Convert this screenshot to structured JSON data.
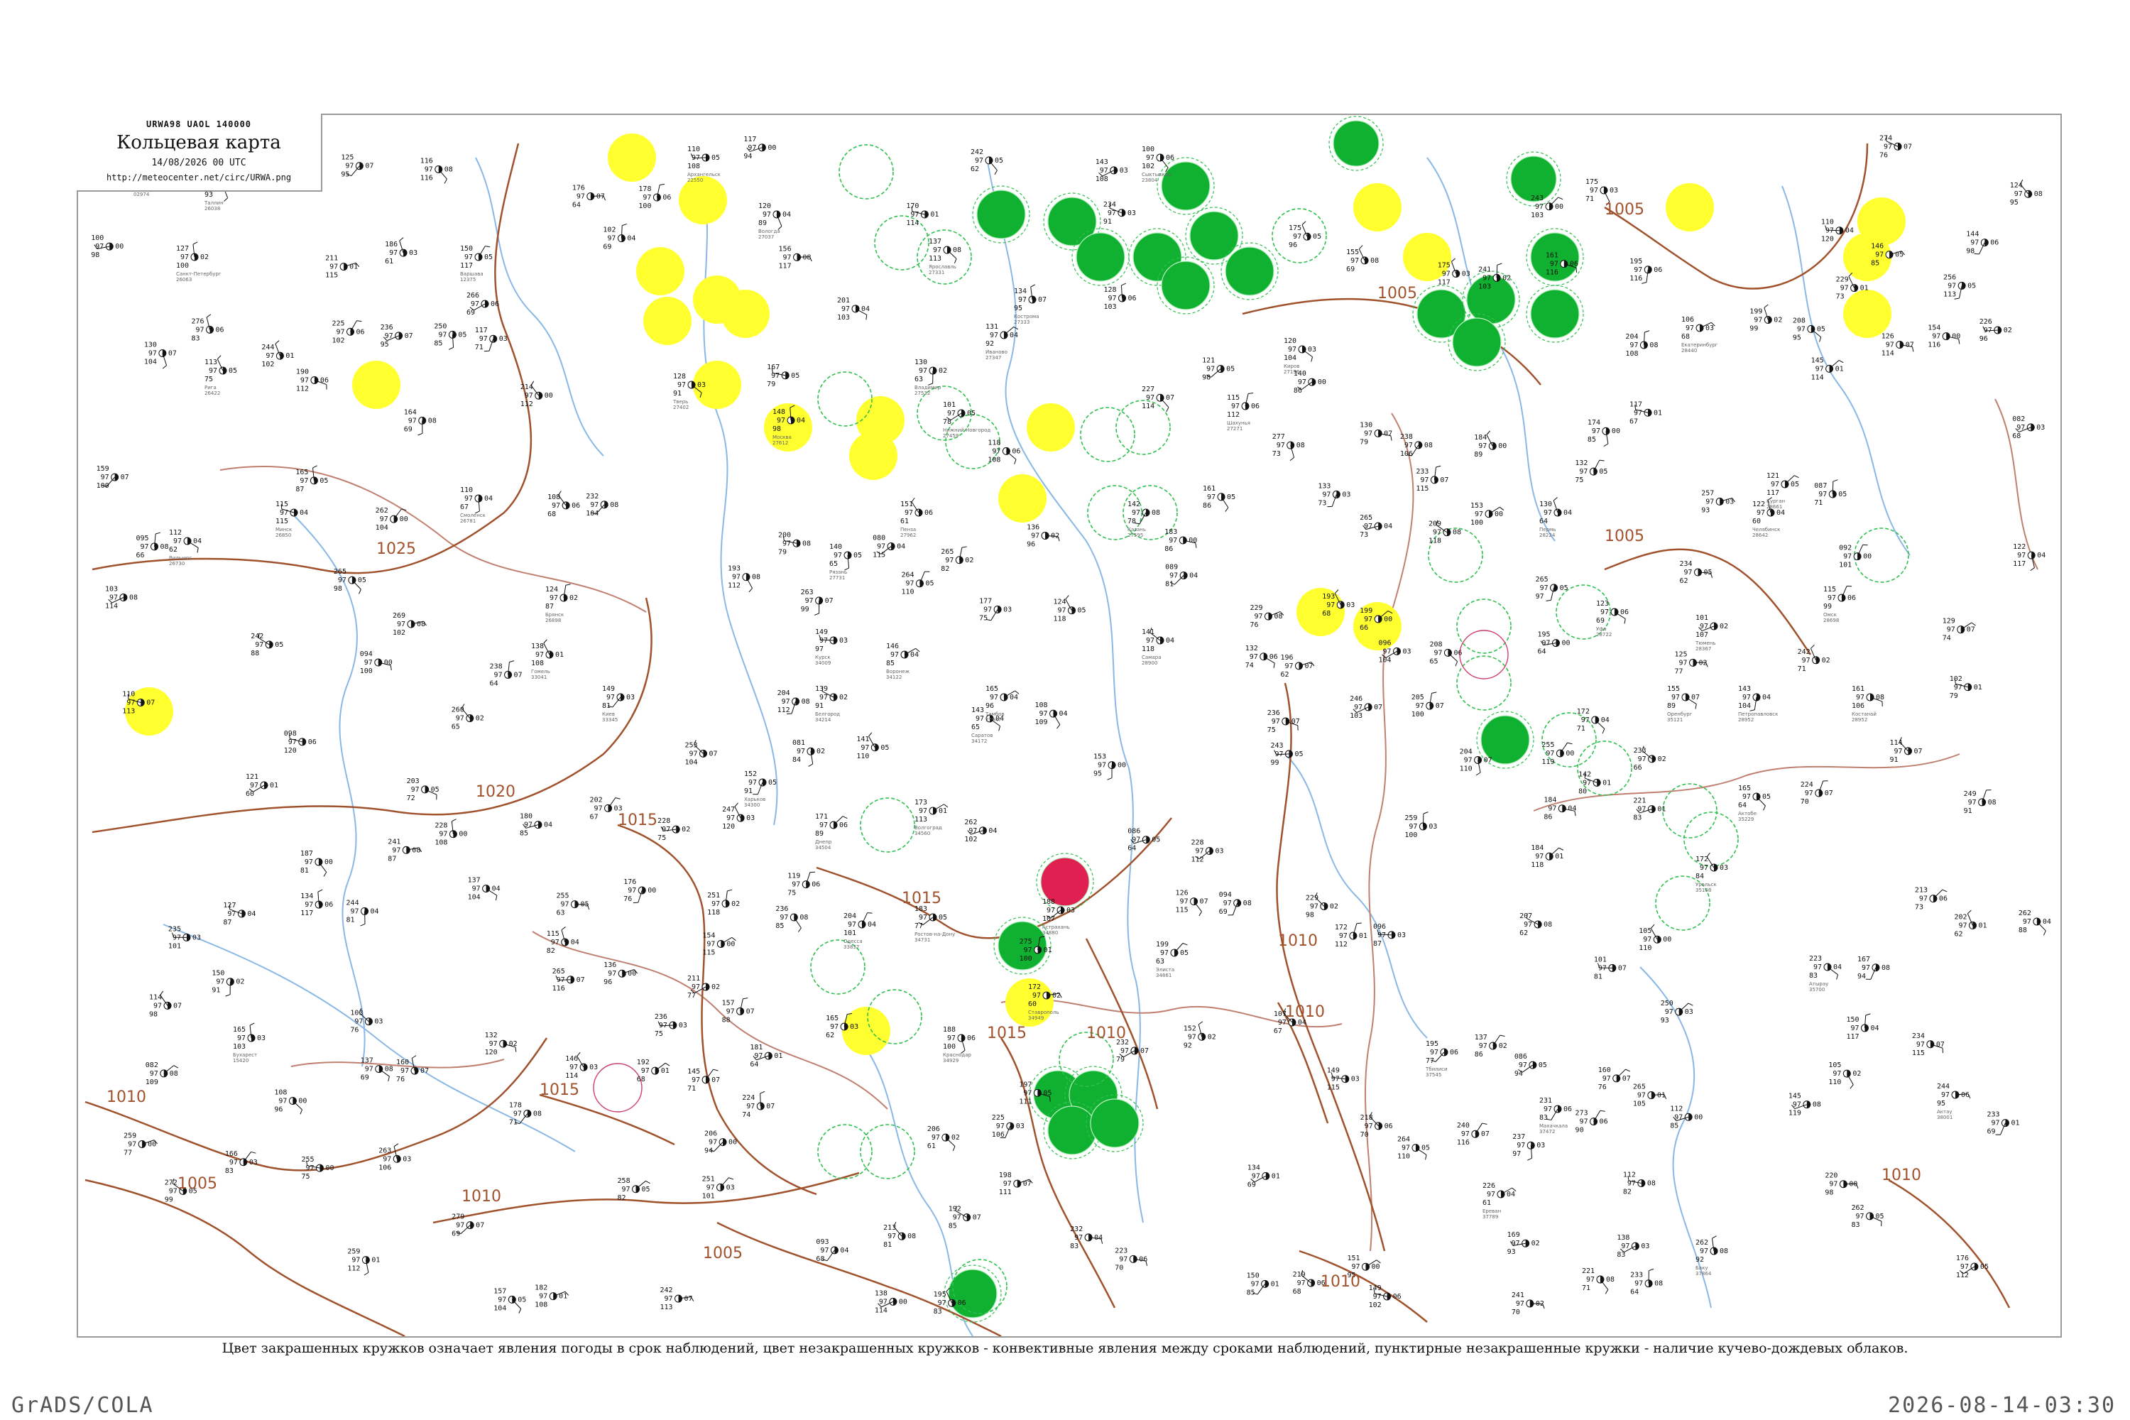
{
  "header": {
    "code": "URWA98  UAOL  140000",
    "title": "Кольцевая карта",
    "datetime": "14/08/2026 00 UTC",
    "url": "http://meteocenter.net/circ/URWA.png"
  },
  "caption": "Цвет закрашенных кружков означает явления погоды в срок наблюдений, цвет незакрашенных кружков - конвективные явления между сроками наблюдений, пунктирные незакрашенные кружки - наличие кучево-дождевых облаков.",
  "footer": {
    "left": "GrADS/COLA",
    "right": "2026-08-14-03:30"
  },
  "colors": {
    "isobar": "#a0522d",
    "river": "#8ab8e6",
    "border": "#c08070",
    "thunderstorm_fill": "#10b030",
    "rain_fill": "#ffff30",
    "hail_fill": "#e02050",
    "cb_dashed": "#30c050",
    "frame": "#9a9a9a"
  },
  "isobars": [
    {
      "label": "1025"
    },
    {
      "label": "1020"
    },
    {
      "label": "1015"
    },
    {
      "label": "1015"
    },
    {
      "label": "1015"
    },
    {
      "label": "1010"
    },
    {
      "label": "1010"
    },
    {
      "label": "1010"
    },
    {
      "label": "1010"
    },
    {
      "label": "1005"
    },
    {
      "label": "1005"
    },
    {
      "label": "1005"
    },
    {
      "label": "1005"
    },
    {
      "label": "1005"
    },
    {
      "label": "1010"
    },
    {
      "label": "1010"
    },
    {
      "label": "1015"
    },
    {
      "label": "1010"
    }
  ],
  "stations": [
    {
      "name": "Кострома",
      "id": "27333",
      "t": "134",
      "p": "97",
      "v": "07"
    },
    {
      "name": "Иваново",
      "id": "27347",
      "t": "131",
      "p": "97",
      "v": "04"
    },
    {
      "name": "Ярославль",
      "id": "27331",
      "t": "137",
      "p": "97",
      "v": "08"
    },
    {
      "name": "Владимир",
      "id": "27532",
      "t": "130",
      "p": "97",
      "v": "02"
    },
    {
      "name": "Нижний Новгород",
      "id": "27459",
      "t": "101",
      "p": "97",
      "v": "05"
    },
    {
      "name": "Шахунья",
      "id": "27271",
      "t": "115",
      "p": "97",
      "v": "06"
    },
    {
      "name": "Киров",
      "id": "27196",
      "t": "120",
      "p": "97",
      "v": "03"
    },
    {
      "name": "Пермь",
      "id": "28224",
      "t": "130",
      "p": "97",
      "v": "04"
    },
    {
      "name": "Казань",
      "id": "27595",
      "t": "142",
      "p": "97",
      "v": "08"
    },
    {
      "name": "Самара",
      "id": "28900",
      "t": "141",
      "p": "97",
      "v": "04"
    },
    {
      "name": "Уфа",
      "id": "28722",
      "t": "123",
      "p": "97",
      "v": "06"
    },
    {
      "name": "Оренбург",
      "id": "35121",
      "t": "155",
      "p": "97",
      "v": "07"
    },
    {
      "name": "Саратов",
      "id": "34172",
      "t": "143",
      "p": "97",
      "v": "04"
    },
    {
      "name": "Волгоград",
      "id": "34560",
      "t": "173",
      "p": "97",
      "v": "01"
    },
    {
      "name": "Астрахань",
      "id": "34880",
      "t": "188",
      "p": "97",
      "v": "03"
    },
    {
      "name": "Воронеж",
      "id": "34122",
      "t": "146",
      "p": "97",
      "v": "04"
    },
    {
      "name": "Курск",
      "id": "34009",
      "t": "149",
      "p": "97",
      "v": "03"
    },
    {
      "name": "Белгород",
      "id": "34214",
      "t": "139",
      "p": "97",
      "v": "02"
    },
    {
      "name": "Ростов-на-Дону",
      "id": "34731",
      "t": "183",
      "p": "97",
      "v": "05"
    },
    {
      "name": "Краснодар",
      "id": "34929",
      "t": "188",
      "p": "97",
      "v": "06"
    },
    {
      "name": "Ставрополь",
      "id": "34949",
      "t": "172",
      "p": "97",
      "v": "02"
    },
    {
      "name": "Элиста",
      "id": "34861",
      "t": "199",
      "p": "97",
      "v": "05"
    },
    {
      "name": "Махачкала",
      "id": "37472",
      "t": "231",
      "p": "97",
      "v": "06"
    },
    {
      "name": "Тамбов",
      "id": "27947",
      "t": "165",
      "p": "97",
      "v": "04"
    },
    {
      "name": "Пенза",
      "id": "27962",
      "t": "151",
      "p": "97",
      "v": "06"
    },
    {
      "name": "Рязань",
      "id": "27731",
      "t": "140",
      "p": "97",
      "v": "05"
    },
    {
      "name": "Москва",
      "id": "27612",
      "t": "148",
      "p": "97",
      "v": "04"
    },
    {
      "name": "Тверь",
      "id": "27402",
      "t": "128",
      "p": "97",
      "v": "03"
    },
    {
      "name": "Смоленск",
      "id": "26781",
      "t": "110",
      "p": "97",
      "v": "04"
    },
    {
      "name": "Брянск",
      "id": "26898",
      "t": "124",
      "p": "97",
      "v": "02"
    },
    {
      "name": "Минск",
      "id": "26850",
      "t": "115",
      "p": "97",
      "v": "04"
    },
    {
      "name": "Гомель",
      "id": "33041",
      "t": "138",
      "p": "97",
      "v": "01"
    },
    {
      "name": "Киев",
      "id": "33345",
      "t": "149",
      "p": "97",
      "v": "03"
    },
    {
      "name": "Харьков",
      "id": "34300",
      "t": "152",
      "p": "97",
      "v": "05"
    },
    {
      "name": "Днепр",
      "id": "34504",
      "t": "171",
      "p": "97",
      "v": "06"
    },
    {
      "name": "Одесса",
      "id": "33837",
      "t": "204",
      "p": "97",
      "v": "04"
    },
    {
      "name": "Санкт-Петербург",
      "id": "26063",
      "t": "127",
      "p": "97",
      "v": "02"
    },
    {
      "name": "Вологда",
      "id": "27037",
      "t": "120",
      "p": "97",
      "v": "04"
    },
    {
      "name": "Архангельск",
      "id": "22550",
      "t": "110",
      "p": "97",
      "v": "05"
    },
    {
      "name": "Сыктывкар",
      "id": "23804",
      "t": "100",
      "p": "97",
      "v": "06"
    },
    {
      "name": "Екатеринбург",
      "id": "28440",
      "t": "106",
      "p": "97",
      "v": "03"
    },
    {
      "name": "Челябинск",
      "id": "28642",
      "t": "122",
      "p": "97",
      "v": "04"
    },
    {
      "name": "Курган",
      "id": "28661",
      "t": "121",
      "p": "97",
      "v": "05"
    },
    {
      "name": "Тюмень",
      "id": "28367",
      "t": "101",
      "p": "97",
      "v": "02"
    },
    {
      "name": "Омск",
      "id": "28698",
      "t": "115",
      "p": "97",
      "v": "06"
    },
    {
      "name": "Петропавловск",
      "id": "28952",
      "t": "143",
      "p": "97",
      "v": "04"
    },
    {
      "name": "Костанай",
      "id": "28952",
      "t": "161",
      "p": "97",
      "v": "08"
    },
    {
      "name": "Актобе",
      "id": "35229",
      "t": "165",
      "p": "97",
      "v": "05"
    },
    {
      "name": "Уральск",
      "id": "35108",
      "t": "172",
      "p": "97",
      "v": "03"
    },
    {
      "name": "Атырау",
      "id": "35700",
      "t": "223",
      "p": "97",
      "v": "04"
    },
    {
      "name": "Актау",
      "id": "38001",
      "t": "244",
      "p": "97",
      "v": "06"
    },
    {
      "name": "Тбилиси",
      "id": "37545",
      "t": "195",
      "p": "97",
      "v": "06"
    },
    {
      "name": "Ереван",
      "id": "37789",
      "t": "226",
      "p": "97",
      "v": "04"
    },
    {
      "name": "Баку",
      "id": "37864",
      "t": "262",
      "p": "97",
      "v": "08"
    },
    {
      "name": "Бухарест",
      "id": "15420",
      "t": "165",
      "p": "97",
      "v": "03"
    },
    {
      "name": "Варшава",
      "id": "12375",
      "t": "150",
      "p": "97",
      "v": "05"
    },
    {
      "name": "Рига",
      "id": "26422",
      "t": "113",
      "p": "97",
      "v": "05"
    },
    {
      "name": "Вильнюс",
      "id": "26730",
      "t": "112",
      "p": "97",
      "v": "04"
    },
    {
      "name": "Таллин",
      "id": "26038",
      "t": "124",
      "p": "97",
      "v": "08"
    },
    {
      "name": "Хельсинки",
      "id": "02974",
      "t": "121",
      "p": "97",
      "v": "01"
    }
  ],
  "weather_dots": [
    {
      "type": "thunderstorm"
    },
    {
      "type": "rain"
    },
    {
      "type": "hail"
    },
    {
      "type": "cb"
    }
  ]
}
